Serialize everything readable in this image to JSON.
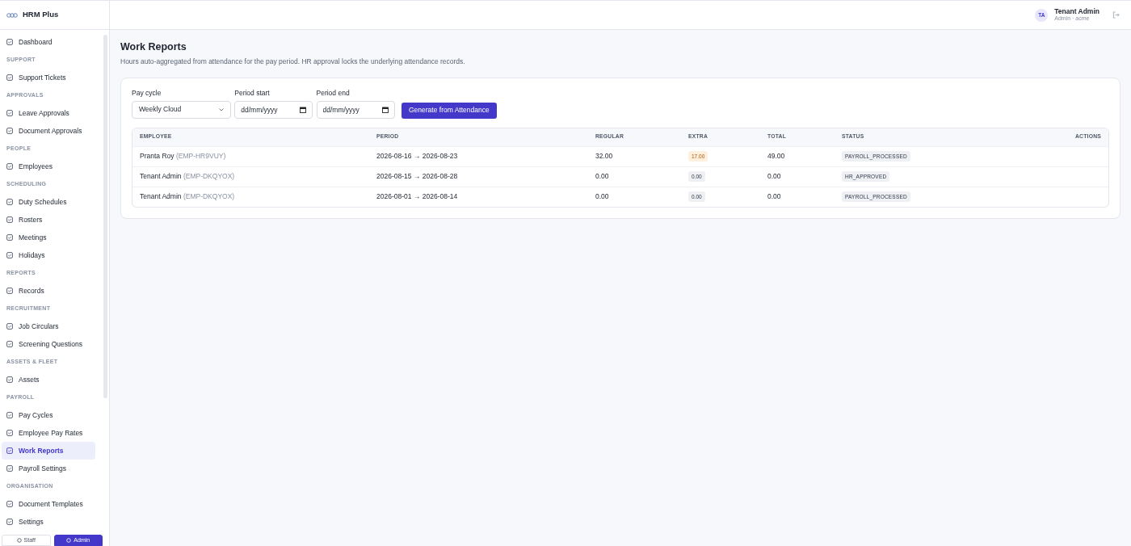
{
  "brand": "HRM Plus",
  "sidebar": {
    "sections": [
      {
        "items": [
          {
            "label": "Dashboard",
            "selected": false
          }
        ]
      },
      {
        "label": "SUPPORT",
        "items": [
          {
            "label": "Support Tickets",
            "selected": false
          }
        ]
      },
      {
        "label": "APPROVALS",
        "items": [
          {
            "label": "Leave Approvals",
            "selected": false
          },
          {
            "label": "Document Approvals",
            "selected": false
          }
        ]
      },
      {
        "label": "PEOPLE",
        "items": [
          {
            "label": "Employees",
            "selected": false
          }
        ]
      },
      {
        "label": "SCHEDULING",
        "items": [
          {
            "label": "Duty Schedules",
            "selected": false
          },
          {
            "label": "Rosters",
            "selected": false
          },
          {
            "label": "Meetings",
            "selected": false
          },
          {
            "label": "Holidays",
            "selected": false
          }
        ]
      },
      {
        "label": "REPORTS",
        "items": [
          {
            "label": "Records",
            "selected": false
          }
        ]
      },
      {
        "label": "RECRUITMENT",
        "items": [
          {
            "label": "Job Circulars",
            "selected": false
          },
          {
            "label": "Screening Questions",
            "selected": false
          }
        ]
      },
      {
        "label": "ASSETS & FLEET",
        "items": [
          {
            "label": "Assets",
            "selected": false
          }
        ]
      },
      {
        "label": "PAYROLL",
        "items": [
          {
            "label": "Pay Cycles",
            "selected": false
          },
          {
            "label": "Employee Pay Rates",
            "selected": false
          },
          {
            "label": "Work Reports",
            "selected": true
          },
          {
            "label": "Payroll Settings",
            "selected": false
          }
        ]
      },
      {
        "label": "ORGANISATION",
        "items": [
          {
            "label": "Document Templates",
            "selected": false
          },
          {
            "label": "Settings",
            "selected": false
          }
        ]
      }
    ],
    "modes": [
      {
        "label": "Staff",
        "selected": false
      },
      {
        "label": "Admin",
        "selected": true
      }
    ]
  },
  "user": {
    "initials": "TA",
    "name": "Tenant Admin",
    "role": "Admin · acme"
  },
  "page": {
    "title": "Work Reports",
    "subtitle": "Hours auto-aggregated from attendance for the pay period. HR approval locks the underlying attendance records."
  },
  "form": {
    "pay_cycle": {
      "label": "Pay cycle",
      "value": "Weekly Cloud"
    },
    "period_start": {
      "label": "Period start",
      "placeholder": "dd/mm/yyyy"
    },
    "period_end": {
      "label": "Period end",
      "placeholder": "dd/mm/yyyy"
    },
    "button": "Generate from Attendance"
  },
  "table": {
    "columns": [
      "EMPLOYEE",
      "PERIOD",
      "REGULAR",
      "EXTRA",
      "TOTAL",
      "STATUS",
      "ACTIONS"
    ],
    "rows": [
      {
        "employee": "Pranta Roy",
        "code": "(EMP-HR9VUY)",
        "period": "2026-08-16 → 2026-08-23",
        "regular": "32.00",
        "extra": "17.00",
        "extra_highlight": true,
        "total": "49.00",
        "status": "PAYROLL_PROCESSED"
      },
      {
        "employee": "Tenant Admin",
        "code": "(EMP-DKQYOX)",
        "period": "2026-08-15 → 2026-08-28",
        "regular": "0.00",
        "extra": "0.00",
        "extra_highlight": false,
        "total": "0.00",
        "status": "HR_APPROVED"
      },
      {
        "employee": "Tenant Admin",
        "code": "(EMP-DKQYOX)",
        "period": "2026-08-01 → 2026-08-14",
        "regular": "0.00",
        "extra": "0.00",
        "extra_highlight": false,
        "total": "0.00",
        "status": "PAYROLL_PROCESSED"
      }
    ]
  }
}
